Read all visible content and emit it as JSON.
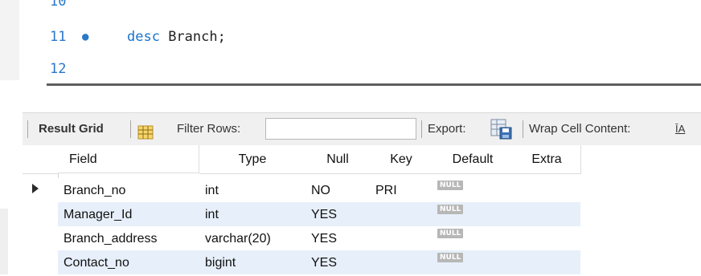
{
  "editor": {
    "lines": [
      {
        "num": "10",
        "keyword": "",
        "text": ""
      },
      {
        "num": "11",
        "dot": "●",
        "keyword": "desc",
        "text": " Branch;"
      },
      {
        "num": "12",
        "keyword": "",
        "text": ""
      }
    ]
  },
  "toolbar": {
    "result_grid_label": "Result Grid",
    "filter_rows_label": "Filter Rows:",
    "filter_value": "",
    "export_label": "Export:",
    "wrap_label": "Wrap Cell Content:",
    "wrap_icon_glyph": "ĪA"
  },
  "grid": {
    "columns": [
      "Field",
      "Type",
      "Null",
      "Key",
      "Default",
      "Extra"
    ],
    "rows": [
      {
        "Field": "Branch_no",
        "Type": "int",
        "Null": "NO",
        "Key": "PRI",
        "Default": "NULL",
        "Extra": "",
        "selected": true
      },
      {
        "Field": "Manager_Id",
        "Type": "int",
        "Null": "YES",
        "Key": "",
        "Default": "NULL",
        "Extra": ""
      },
      {
        "Field": "Branch_address",
        "Type": "varchar(20)",
        "Null": "YES",
        "Key": "",
        "Default": "NULL",
        "Extra": ""
      },
      {
        "Field": "Contact_no",
        "Type": "bigint",
        "Null": "YES",
        "Key": "",
        "Default": "NULL",
        "Extra": ""
      }
    ]
  },
  "colors": {
    "line_number": "#2b78c8",
    "keyword": "#1a73c9",
    "row_alt": "#e7effa",
    "null_badge": "#b7b7b7"
  }
}
